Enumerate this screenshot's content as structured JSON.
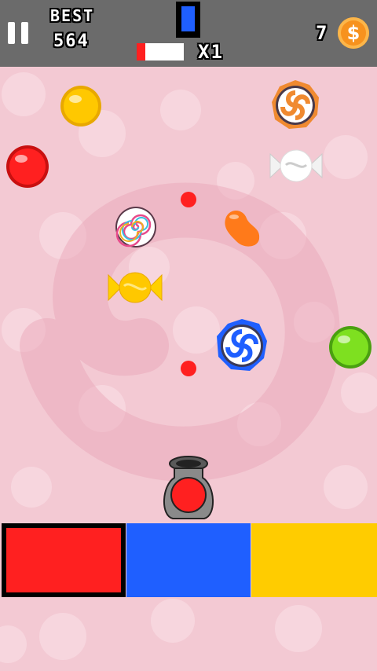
{
  "hud": {
    "best_label": "BEST",
    "best_value": "564",
    "current_color": "#1f5fff",
    "progress_fraction": 0.18,
    "progress_color": "#ff2020",
    "multiplier": "X1",
    "coins": "7",
    "coin_symbol": "$"
  },
  "candies": [
    {
      "type": "yellow-ball",
      "color": "#ffc800"
    },
    {
      "type": "orange-swirl-lollipop",
      "color": "#f08a30"
    },
    {
      "type": "red-ball",
      "color": "#ff2020"
    },
    {
      "type": "white-wrapped-candy",
      "color": "#ffffff"
    },
    {
      "type": "rainbow-swirl-lollipop",
      "color": "#ffffff"
    },
    {
      "type": "orange-jelly-bean",
      "color": "#ff8a2a"
    },
    {
      "type": "yellow-wrapped-candy",
      "color": "#ffc800"
    },
    {
      "type": "blue-swirl-lollipop",
      "color": "#1f5fff"
    },
    {
      "type": "green-ball",
      "color": "#7ee020"
    }
  ],
  "bullets": [
    {
      "color": "#ff2020"
    },
    {
      "color": "#ff2020"
    }
  ],
  "cannon": {
    "loaded_color": "#ff2020"
  },
  "color_buttons": [
    {
      "color": "#ff2020",
      "selected": true
    },
    {
      "color": "#1f5fff",
      "selected": false
    },
    {
      "color": "#ffcc00",
      "selected": false
    }
  ]
}
